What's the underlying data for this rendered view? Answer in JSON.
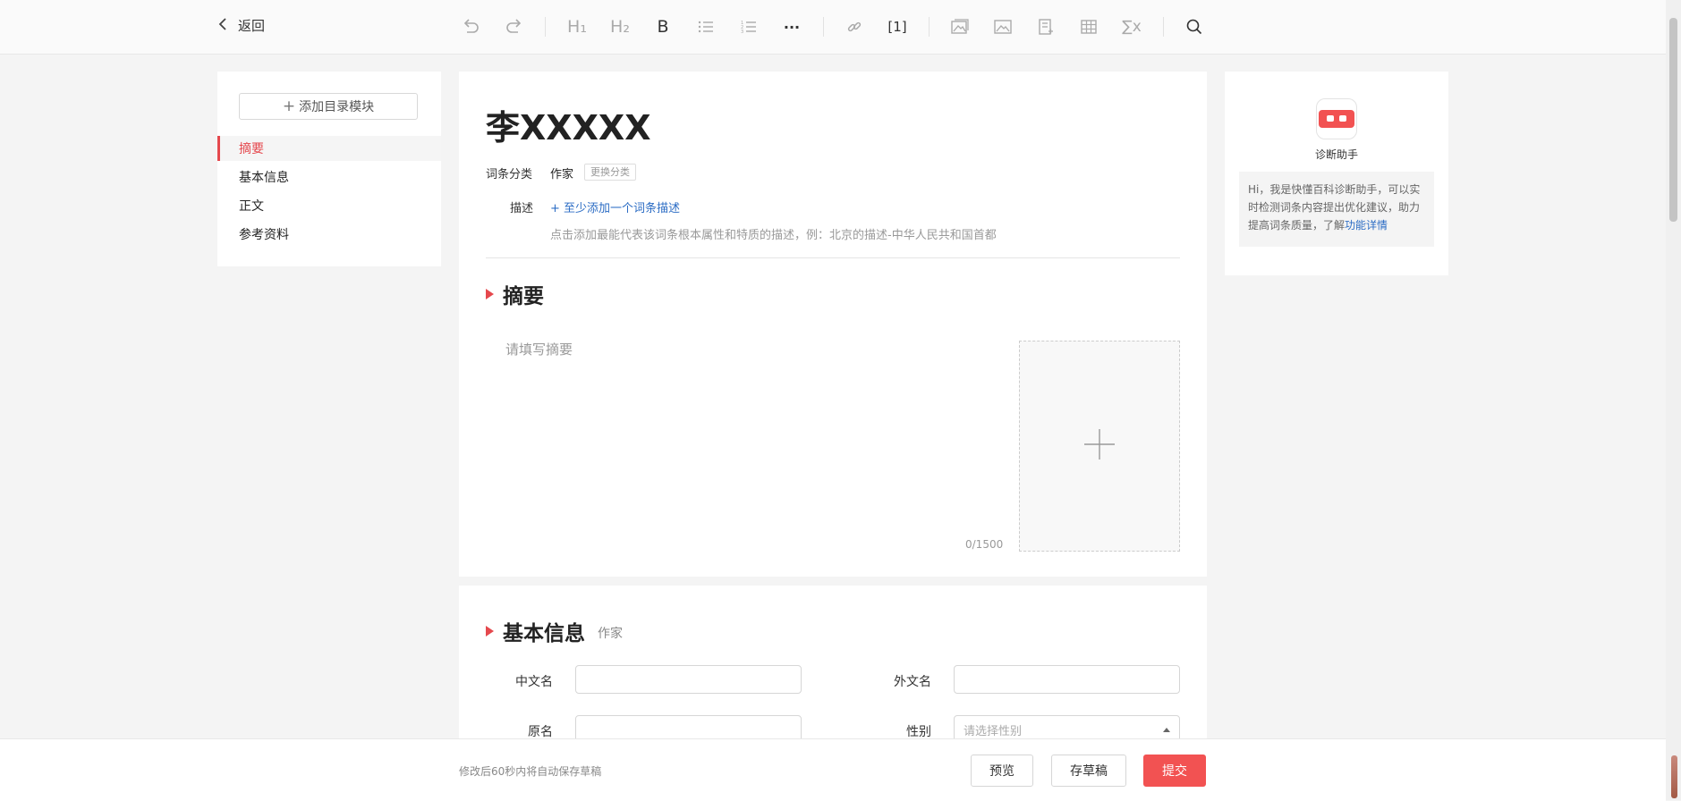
{
  "toolbar": {
    "back_label": "返回",
    "h1_label": "H₁",
    "h2_label": "H₂",
    "bold_label": "B",
    "more_label": "···",
    "cite_label": "[1]",
    "formula_label": "∑x",
    "icons": [
      "undo-icon",
      "redo-icon",
      "heading1-icon",
      "heading2-icon",
      "bold-icon",
      "bullet-list-icon",
      "numbered-list-icon",
      "more-icon",
      "link-icon",
      "citation-icon",
      "image-gallery-icon",
      "image-icon",
      "notes-icon",
      "table-icon",
      "formula-icon",
      "search-icon"
    ]
  },
  "sidebar": {
    "add_label": "添加目录模块",
    "items": [
      {
        "label": "摘要",
        "active": true
      },
      {
        "label": "基本信息",
        "active": false
      },
      {
        "label": "正文",
        "active": false
      },
      {
        "label": "参考资料",
        "active": false
      }
    ]
  },
  "entry": {
    "title": "李XXXXX",
    "category_label": "词条分类",
    "category_value": "作家",
    "change_category": "更换分类",
    "desc_label": "描述",
    "desc_add": "+ 至少添加一个词条描述",
    "desc_hint": "点击添加最能代表该词条根本属性和特质的描述，例：北京的描述-中华人民共和国首都"
  },
  "summary": {
    "heading": "摘要",
    "placeholder": "请填写摘要",
    "counter": "0/1500"
  },
  "basic_info": {
    "heading": "基本信息",
    "sub": "作家",
    "fields": {
      "chinese_name": "中文名",
      "foreign_name": "外文名",
      "original_name": "原名",
      "gender": "性别",
      "gender_placeholder": "请选择性别"
    }
  },
  "assistant": {
    "name": "诊断助手",
    "message": "Hi，我是快懂百科诊断助手，可以实时检测词条内容提出优化建议，助力提高词条质量，了解",
    "link": "功能详情"
  },
  "footer": {
    "autosave": "修改后60秒内将自动保存草稿",
    "preview": "预览",
    "draft": "存草稿",
    "submit": "提交"
  },
  "colors": {
    "accent": "#f25252",
    "link": "#2b6cc4"
  }
}
